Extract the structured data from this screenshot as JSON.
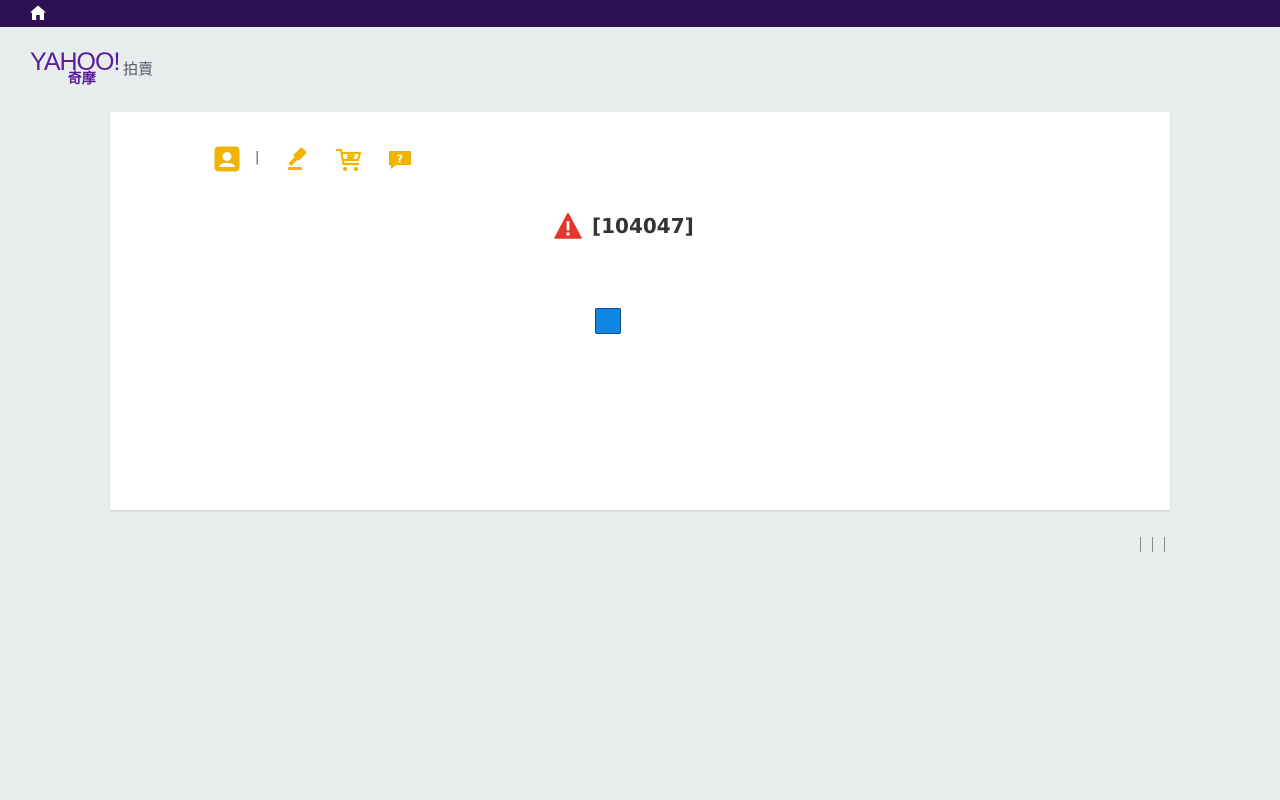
{
  "topbar": {
    "home_icon": "home-icon"
  },
  "logo": {
    "brand": "YAHOO!",
    "brand_cn": "奇摩",
    "service": "拍賣"
  },
  "nav": {
    "icons": [
      "account-icon",
      "gavel-icon",
      "cart-icon",
      "help-chat-icon"
    ],
    "separator": "|",
    "icon_color": "#f0b400"
  },
  "error": {
    "icon": "warning-icon",
    "code": "[104047]",
    "icon_color": "#e8352b"
  },
  "action_button": {
    "label": "",
    "color": "#0f86e3"
  },
  "footer": {
    "links": [
      "",
      "",
      "",
      ""
    ]
  },
  "colors": {
    "topbar": "#2d1152",
    "background": "#e7ecec",
    "brand": "#5d1a9b"
  }
}
